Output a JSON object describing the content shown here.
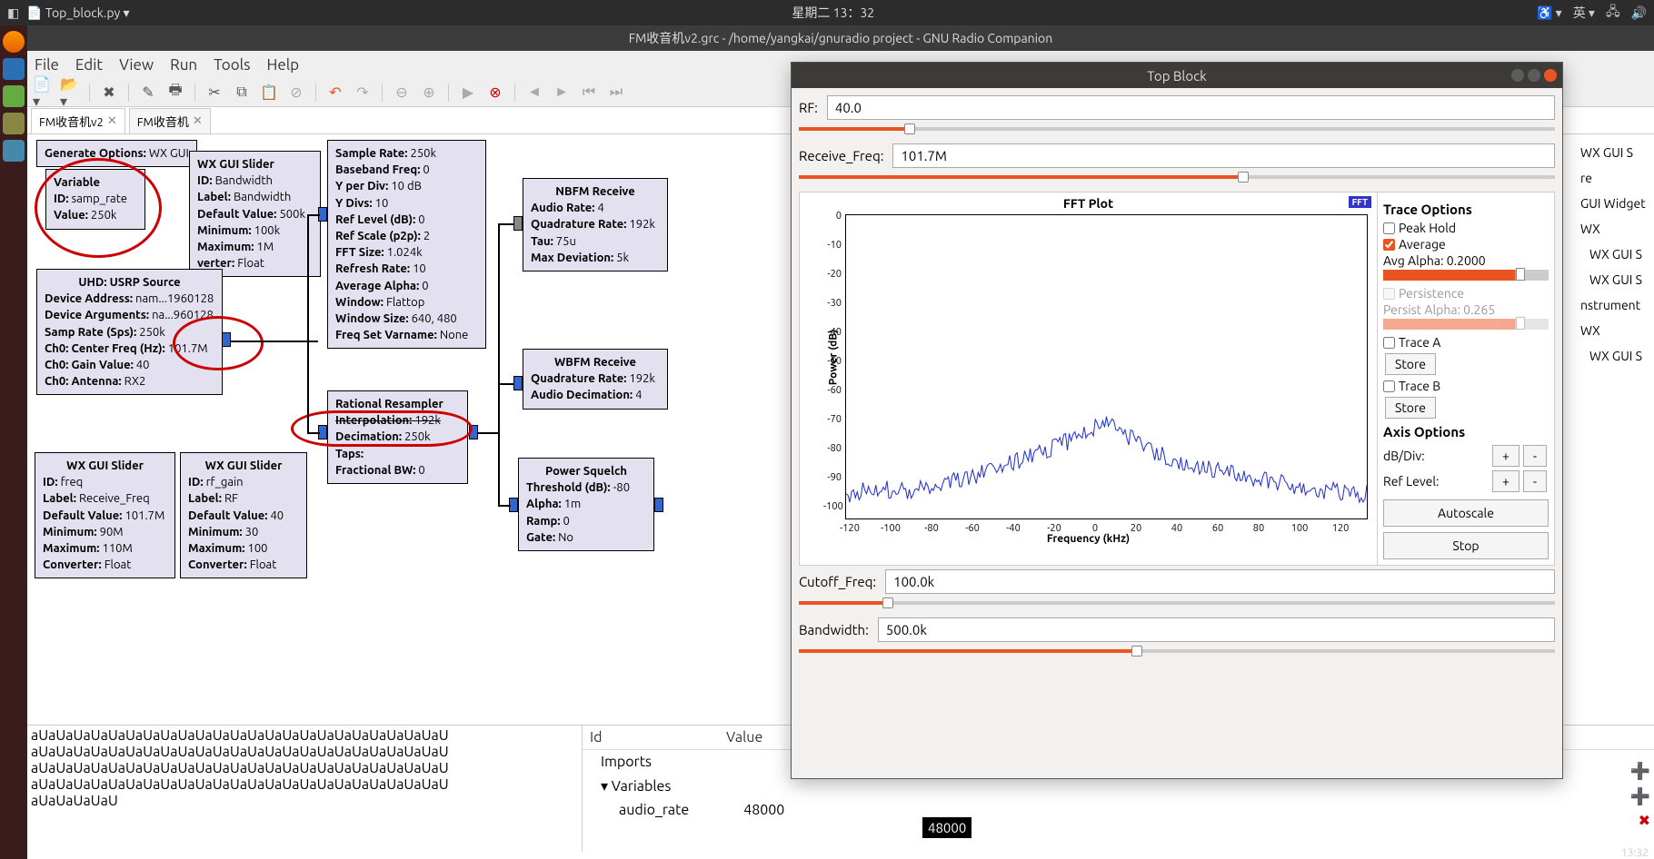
{
  "os": {
    "app_icon": "🦊",
    "topfile": "Top_block.py",
    "clock": "星期二 13：32",
    "tray": [
      "accessibility",
      "英",
      "network",
      "volume"
    ],
    "bottom_time": "13:32"
  },
  "grc": {
    "title": "FM收音机v2.grc - /home/yangkai/gnuradio project - GNU Radio Companion",
    "menu": [
      "File",
      "Edit",
      "View",
      "Run",
      "Tools",
      "Help"
    ],
    "tabs": [
      {
        "label": "FM收音机v2",
        "active": true
      },
      {
        "label": "FM收音机",
        "active": false
      }
    ]
  },
  "blocks": {
    "options": {
      "gen_opt_lbl": "Generate Options:",
      "gen_opt_val": "WX GUI"
    },
    "variable": {
      "title": "Variable",
      "id_lbl": "ID:",
      "id_val": "samp_rate",
      "val_lbl": "Value:",
      "val_val": "250k"
    },
    "slider_bw": {
      "title": "WX GUI Slider",
      "id_lbl": "ID:",
      "id_val": "Bandwidth",
      "label_lbl": "Label:",
      "label_val": "Bandwidth",
      "def_lbl": "Default Value:",
      "def_val": "500k",
      "min_lbl": "Minimum:",
      "min_val": "100k",
      "max_lbl": "Maximum:",
      "max_val": "1M",
      "conv_lbl": "verter:",
      "conv_val": "Float"
    },
    "usrp": {
      "title": "UHD: USRP Source",
      "addr_lbl": "Device Address:",
      "addr_val": "nam...1960128",
      "arg_lbl": "Device Arguments:",
      "arg_val": "na...960128",
      "sr_lbl": "Samp Rate (Sps):",
      "sr_val": "250k",
      "cf_lbl": "Ch0: Center Freq (Hz):",
      "cf_val": "101.7M",
      "gain_lbl": "Ch0: Gain Value:",
      "gain_val": "40",
      "ant_lbl": "Ch0: Antenna:",
      "ant_val": "RX2"
    },
    "fftsink": {
      "sr_lbl": "Sample Rate:",
      "sr_val": "250k",
      "bb_lbl": "Baseband Freq:",
      "bb_val": "0",
      "ypd_lbl": "Y per Div:",
      "ypd_val": "10 dB",
      "yd_lbl": "Y Divs:",
      "yd_val": "10",
      "rl_lbl": "Ref Level (dB):",
      "rl_val": "0",
      "rs_lbl": "Ref Scale (p2p):",
      "rs_val": "2",
      "fs_lbl": "FFT Size:",
      "fs_val": "1.024k",
      "rr_lbl": "Refresh Rate:",
      "rr_val": "10",
      "aa_lbl": "Average Alpha:",
      "aa_val": "0",
      "win_lbl": "Window:",
      "win_val": "Flattop",
      "ws_lbl": "Window Size:",
      "ws_val": "640, 480",
      "fv_lbl": "Freq Set Varname:",
      "fv_val": "None"
    },
    "resamp": {
      "title": "Rational Resampler",
      "int_lbl": "Interpolation:",
      "int_val": "192k",
      "dec_lbl": "Decimation:",
      "dec_val": "250k",
      "taps_lbl": "Taps:",
      "fbw_lbl": "Fractional BW:",
      "fbw_val": "0"
    },
    "slider_freq": {
      "title": "WX GUI Slider",
      "id_lbl": "ID:",
      "id_val": "freq",
      "label_lbl": "Label:",
      "label_val": "Receive_Freq",
      "def_lbl": "Default Value:",
      "def_val": "101.7M",
      "min_lbl": "Minimum:",
      "min_val": "90M",
      "max_lbl": "Maximum:",
      "max_val": "110M",
      "conv_lbl": "Converter:",
      "conv_val": "Float"
    },
    "slider_rf": {
      "title": "WX GUI Slider",
      "id_lbl": "ID:",
      "id_val": "rf_gain",
      "label_lbl": "Label:",
      "label_val": "RF",
      "def_lbl": "Default Value:",
      "def_val": "40",
      "min_lbl": "Minimum:",
      "min_val": "30",
      "max_lbl": "Maximum:",
      "max_val": "100",
      "conv_lbl": "Converter:",
      "conv_val": "Float"
    },
    "nbfm": {
      "title": "NBFM Receive",
      "ar_lbl": "Audio Rate:",
      "ar_val": "4",
      "qr_lbl": "Quadrature Rate:",
      "qr_val": "192k",
      "tau_lbl": "Tau:",
      "tau_val": "75u",
      "md_lbl": "Max Deviation:",
      "md_val": "5k"
    },
    "wbfm": {
      "title": "WBFM Receive",
      "qr_lbl": "Quadrature Rate:",
      "qr_val": "192k",
      "ad_lbl": "Audio Decimation:",
      "ad_val": "4"
    },
    "squelch": {
      "title": "Power Squelch",
      "thr_lbl": "Threshold (dB):",
      "thr_val": "-80",
      "alpha_lbl": "Alpha:",
      "alpha_val": "1m",
      "ramp_lbl": "Ramp:",
      "ramp_val": "0",
      "gate_lbl": "Gate:",
      "gate_val": "No"
    }
  },
  "bottom": {
    "log_line": "aUaUaUaUaUaUaUaUaUaUaUaUaUaUaUaUaUaUaUaUaUaUaUaU",
    "log_last": "aUaUaUaUaU",
    "id_hdr": "Id",
    "val_hdr": "Value",
    "imports": "Imports",
    "variables": "Variables",
    "audio_rate": "audio_rate",
    "audio_rate_val": "48000",
    "tooltip": "48000"
  },
  "sidebar": {
    "items": [
      "WX GUI S",
      "re",
      "GUI Widget",
      "WX",
      "WX GUI S",
      "WX GUI S",
      "nstrument",
      "WX",
      "WX GUI S"
    ]
  },
  "tb": {
    "title": "Top Block",
    "rf_lbl": "RF:",
    "rf_val": "40.0",
    "rf_pct": 14,
    "freq_lbl": "Receive_Freq:",
    "freq_val": "101.7M",
    "freq_pct": 58,
    "cutoff_lbl": "Cutoff_Freq:",
    "cutoff_val": "100.0k",
    "cutoff_pct": 11,
    "bw_lbl": "Bandwidth:",
    "bw_val": "500.0k",
    "bw_pct": 44,
    "fft": {
      "title": "FFT Plot",
      "btn": "FFT",
      "ylabel": "Power (dB)",
      "xlabel": "Frequency (kHz)",
      "yticks": [
        "0",
        "-10",
        "-20",
        "-30",
        "-40",
        "-50",
        "-60",
        "-70",
        "-80",
        "-90",
        "-100"
      ],
      "xticks": [
        "-120",
        "-100",
        "-80",
        "-60",
        "-40",
        "-20",
        "0",
        "20",
        "40",
        "60",
        "80",
        "100",
        "120"
      ]
    },
    "controls": {
      "trace_hdr": "Trace Options",
      "peak": "Peak Hold",
      "avg": "Average",
      "avg_alpha": "Avg Alpha: 0.2000",
      "persist": "Persistence",
      "persist_alpha": "Persist Alpha: 0.265",
      "traceA": "Trace A",
      "traceB": "Trace B",
      "store": "Store",
      "axis_hdr": "Axis Options",
      "dbdiv": "dB/Div:",
      "reflevel": "Ref Level:",
      "plus": "+",
      "minus": "-",
      "autoscale": "Autoscale",
      "stop": "Stop"
    }
  },
  "chart_data": {
    "type": "line",
    "title": "FFT Plot",
    "xlabel": "Frequency (kHz)",
    "ylabel": "Power (dB)",
    "xlim": [
      -125,
      125
    ],
    "ylim": [
      -100,
      0
    ],
    "x": [
      -125,
      -110,
      -95,
      -80,
      -65,
      -50,
      -35,
      -20,
      -10,
      0,
      10,
      20,
      35,
      50,
      65,
      80,
      95,
      110,
      125
    ],
    "values": [
      -92,
      -90,
      -91,
      -88,
      -86,
      -83,
      -79,
      -75,
      -72,
      -68,
      -73,
      -77,
      -81,
      -84,
      -86,
      -88,
      -90,
      -91,
      -92
    ]
  }
}
